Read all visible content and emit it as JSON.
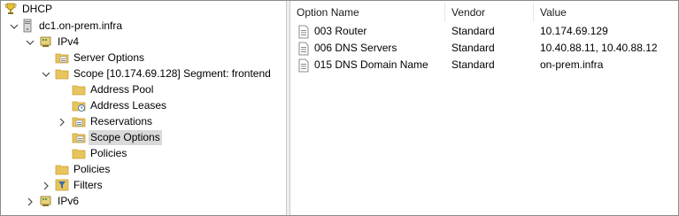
{
  "tree": {
    "root": "DHCP",
    "server": "dc1.on-prem.infra",
    "ipv4": "IPv4",
    "server_options": "Server Options",
    "scope": "Scope [10.174.69.128] Segment: frontend",
    "address_pool": "Address Pool",
    "address_leases": "Address Leases",
    "reservations": "Reservations",
    "scope_options": "Scope Options",
    "scope_policies": "Policies",
    "policies": "Policies",
    "filters": "Filters",
    "ipv6": "IPv6"
  },
  "list": {
    "columns": [
      "Option Name",
      "Vendor",
      "Value"
    ],
    "rows": [
      {
        "name": "003 Router",
        "vendor": "Standard",
        "value": "10.174.69.129"
      },
      {
        "name": "006 DNS Servers",
        "vendor": "Standard",
        "value": "10.40.88.11, 10.40.88.12"
      },
      {
        "name": "015 DNS Domain Name",
        "vendor": "Standard",
        "value": "on-prem.infra"
      }
    ]
  },
  "colors": {
    "folder": "#e8c45c",
    "folder_dark": "#c9a133",
    "selection": "#d9d9d9",
    "text": "#000000"
  },
  "icons": {
    "root": "trophy-icon",
    "server": "server-icon",
    "folder": "folder-icon",
    "filter": "funnel-icon",
    "document": "document-icon"
  }
}
